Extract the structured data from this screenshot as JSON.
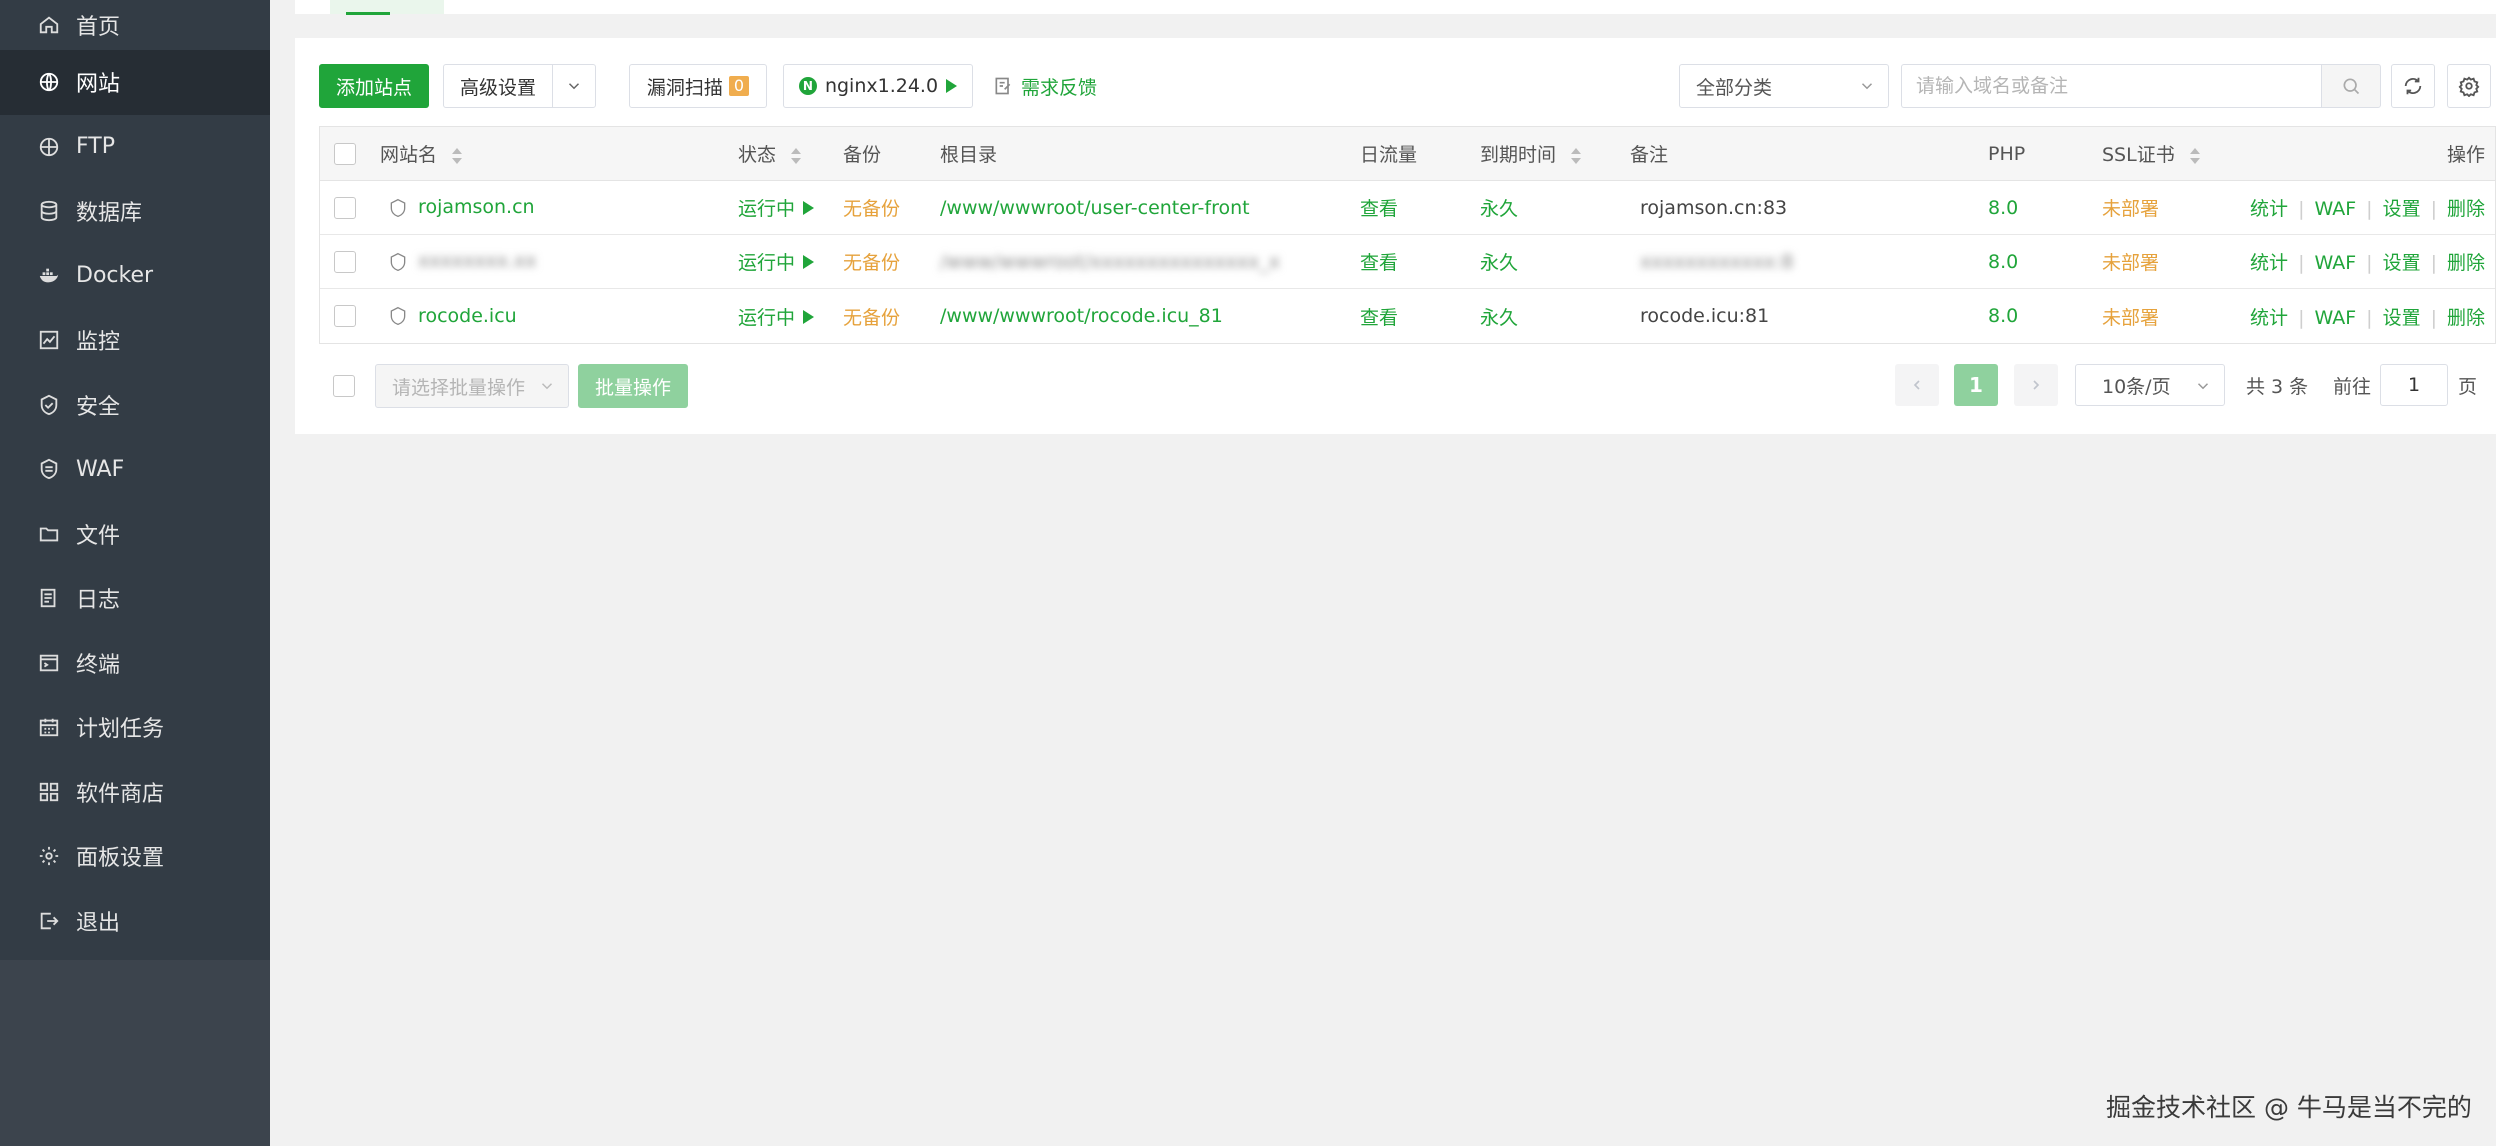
{
  "sidebar": {
    "items": [
      {
        "label": "首页",
        "icon": "home-icon"
      },
      {
        "label": "网站",
        "icon": "globe-icon",
        "active": true
      },
      {
        "label": "FTP",
        "icon": "ftp-icon"
      },
      {
        "label": "数据库",
        "icon": "database-icon"
      },
      {
        "label": "Docker",
        "icon": "docker-icon"
      },
      {
        "label": "监控",
        "icon": "monitor-icon"
      },
      {
        "label": "安全",
        "icon": "shield-icon"
      },
      {
        "label": "WAF",
        "icon": "waf-icon"
      },
      {
        "label": "文件",
        "icon": "folder-icon"
      },
      {
        "label": "日志",
        "icon": "log-icon"
      },
      {
        "label": "终端",
        "icon": "terminal-icon"
      },
      {
        "label": "计划任务",
        "icon": "calendar-icon"
      },
      {
        "label": "软件商店",
        "icon": "apps-icon"
      },
      {
        "label": "面板设置",
        "icon": "gear-icon"
      },
      {
        "label": "退出",
        "icon": "logout-icon"
      }
    ]
  },
  "toolbar": {
    "add_site": "添加站点",
    "advanced": "高级设置",
    "vuln_scan": "漏洞扫描",
    "vuln_count": "0",
    "nginx": "nginx1.24.0",
    "feedback": "需求反馈",
    "category": "全部分类",
    "search_placeholder": "请输入域名或备注"
  },
  "table": {
    "headers": {
      "name": "网站名",
      "status": "状态",
      "backup": "备份",
      "root": "根目录",
      "traffic": "日流量",
      "expire": "到期时间",
      "remark": "备注",
      "php": "PHP",
      "ssl": "SSL证书",
      "ops": "操作"
    },
    "rows": [
      {
        "name": "rojamson.cn",
        "status": "运行中",
        "backup": "无备份",
        "root": "/www/wwwroot/user-center-front",
        "traffic": "查看",
        "expire": "永久",
        "remark": "rojamson.cn:83",
        "php": "8.0",
        "ssl": "未部署",
        "blurred": false
      },
      {
        "name": "xxxxxxxx.xx",
        "status": "运行中",
        "backup": "无备份",
        "root": "/www/wwwroot/xxxxxxxxxxxxxxx_x",
        "traffic": "查看",
        "expire": "永久",
        "remark": "xxxxxxxxxxxx:8",
        "php": "8.0",
        "ssl": "未部署",
        "blurred": true
      },
      {
        "name": "rocode.icu",
        "status": "运行中",
        "backup": "无备份",
        "root": "/www/wwwroot/rocode.icu_81",
        "traffic": "查看",
        "expire": "永久",
        "remark": "rocode.icu:81",
        "php": "8.0",
        "ssl": "未部署",
        "blurred": false
      }
    ],
    "row_actions": {
      "stats": "统计",
      "waf": "WAF",
      "settings": "设置",
      "delete": "删除"
    }
  },
  "batch": {
    "select_placeholder": "请选择批量操作",
    "button": "批量操作"
  },
  "pagination": {
    "current_page": "1",
    "page_size": "10条/页",
    "total": "共 3 条",
    "goto_label": "前往",
    "goto_value": "1",
    "page_unit": "页"
  },
  "watermark": "掘金技术社区 @ 牛马是当不完的",
  "colors": {
    "accent": "#20a53a",
    "warning": "#e6a23c",
    "sidebar": "#333c45"
  }
}
